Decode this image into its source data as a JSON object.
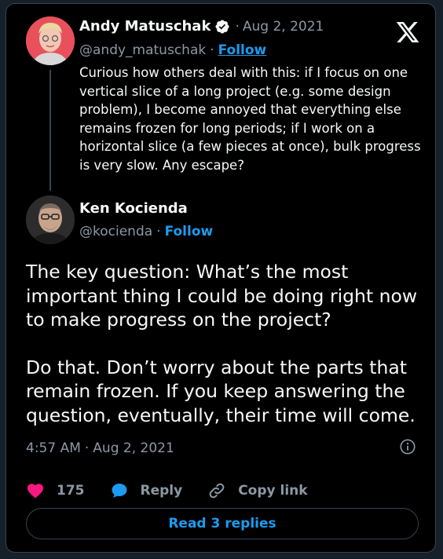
{
  "quoted_tweet": {
    "author_name": "Andy Matuschak",
    "handle": "@andy_matuschak",
    "date": "Aug 2, 2021",
    "follow_label": "Follow",
    "text": "Curious how others deal with this: if I focus on one vertical slice of a long project (e.g. some design problem), I become annoyed that everything else remains frozen for long periods; if I work on a horizontal slice (a few pieces at once), bulk progress is very slow. Any escape?",
    "verified": true,
    "avatar_icon": "portrait-avatar"
  },
  "reply_tweet": {
    "author_name": "Ken Kocienda",
    "handle": "@kocienda",
    "follow_label": "Follow",
    "paragraph_1": "The key question: What’s the most important thing I could be doing right now to make progress on the project?",
    "paragraph_2": "Do that. Don’t worry about the parts that remain frozen. If you keep answering the question, eventually, their time will come.",
    "time": "4:57 AM",
    "date": "Aug 2, 2021",
    "avatar_icon": "portrait-avatar"
  },
  "separator": "·",
  "actions": {
    "like_count": "175",
    "reply_label": "Reply",
    "copy_link_label": "Copy link"
  },
  "read_replies_label": "Read 3 replies",
  "colors": {
    "background": "#15202b",
    "card": "#000000",
    "accent": "#1d9bf0",
    "like": "#f91880",
    "muted": "#8b98a5",
    "border": "#38444d"
  },
  "icons": [
    "x-logo-icon",
    "verified-badge-icon",
    "info-icon",
    "heart-icon",
    "reply-bubble-icon",
    "link-icon"
  ]
}
